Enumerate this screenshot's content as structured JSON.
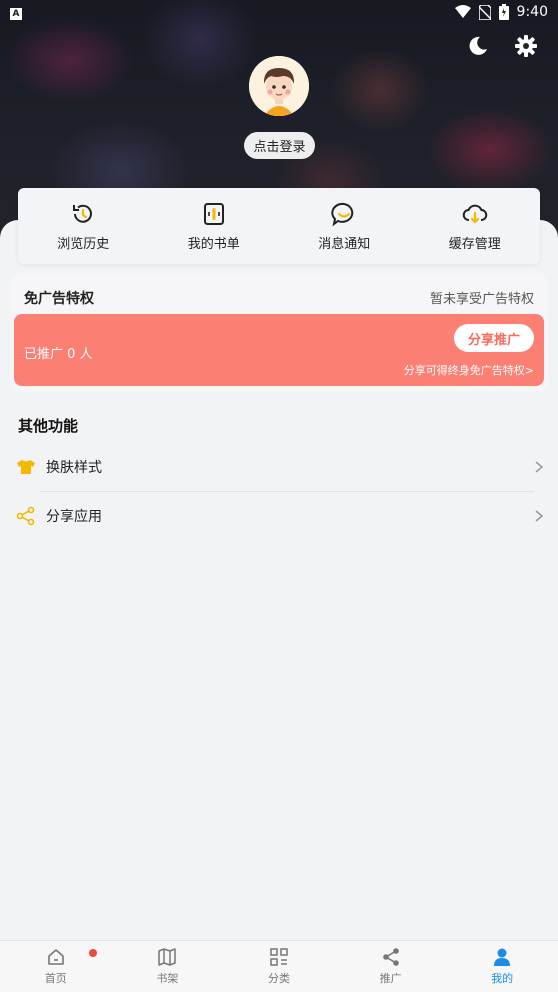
{
  "status_bar": {
    "time": "9:40",
    "left_badge": "A"
  },
  "header": {
    "icons": [
      "moon-icon",
      "gear-icon"
    ],
    "login_label": "点击登录"
  },
  "quick_actions": [
    {
      "label": "浏览历史",
      "icon": "history-icon"
    },
    {
      "label": "我的书单",
      "icon": "booklist-icon"
    },
    {
      "label": "消息通知",
      "icon": "message-icon"
    },
    {
      "label": "缓存管理",
      "icon": "cloud-download-icon"
    }
  ],
  "ad_free": {
    "title": "免广告特权",
    "status": "暂未享受广告特权",
    "promo_count_label": "已推广 0 人",
    "share_button": "分享推广",
    "hint": "分享可得终身免广告特权>"
  },
  "other_functions": {
    "title": "其他功能",
    "items": [
      {
        "label": "换肤样式",
        "icon": "tshirt-icon"
      },
      {
        "label": "分享应用",
        "icon": "share-icon"
      }
    ]
  },
  "colors": {
    "accent_blue": "#1a8de8",
    "banner": "#fb7f73",
    "icon_yellow": "#f5b800"
  },
  "bottom_nav": [
    {
      "label": "首页",
      "icon": "home-icon",
      "badge": true
    },
    {
      "label": "书架",
      "icon": "bookshelf-icon"
    },
    {
      "label": "分类",
      "icon": "category-icon"
    },
    {
      "label": "推广",
      "icon": "share-icon"
    },
    {
      "label": "我的",
      "icon": "user-icon",
      "active": true
    }
  ]
}
